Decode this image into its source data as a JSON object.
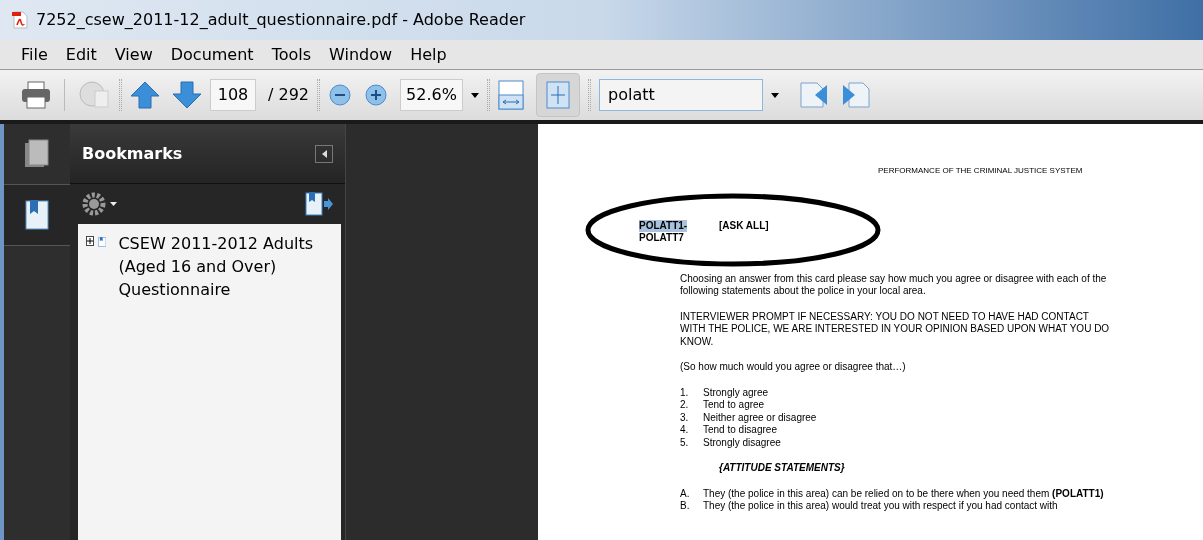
{
  "window": {
    "title": "7252_csew_2011-12_adult_questionnaire.pdf - Adobe Reader"
  },
  "menu": [
    "File",
    "Edit",
    "View",
    "Document",
    "Tools",
    "Window",
    "Help"
  ],
  "toolbar": {
    "page": "108",
    "page_total": "/ 292",
    "zoom": "52.6%",
    "search": "polatt",
    "fit_page_selected": true
  },
  "bookmarks": {
    "title": "Bookmarks",
    "items": [
      {
        "label": "CSEW 2011-2012 Adults (Aged 16 and Over) Questionnaire",
        "expanded": false
      }
    ]
  },
  "document": {
    "header": "PERFORMANCE OF THE CRIMINAL JUSTICE SYSTEM",
    "code_lines": [
      {
        "text": "POLATT1-",
        "selected": true
      },
      {
        "text": "POLATT7",
        "selected": false
      }
    ],
    "ask": "[ASK ALL]",
    "question": "Choosing an answer from this card please say how much you agree or disagree with each of the following statements about the police in your local area.",
    "prompt": "INTERVIEWER PROMPT IF NECESSARY: YOU DO NOT NEED TO HAVE HAD CONTACT WITH THE POLICE, WE ARE INTERESTED IN YOUR OPINION BASED UPON WHAT YOU DO KNOW.",
    "lead": "(So how much would you agree or disagree that…)",
    "options": [
      {
        "num": "1.",
        "text": "Strongly agree"
      },
      {
        "num": "2.",
        "text": "Tend to agree"
      },
      {
        "num": "3.",
        "text": "Neither agree or disagree"
      },
      {
        "num": "4.",
        "text": "Tend to disagree"
      },
      {
        "num": "5.",
        "text": "Strongly disagree"
      }
    ],
    "section": "{ATTITUDE STATEMENTS}",
    "statements": [
      {
        "letter": "A.",
        "text": "They (the police in this area) can be relied on to be there when you need them **(POLATT1)**"
      },
      {
        "letter": "B.",
        "text": "They (the police in this area) would treat you with respect if you had contact with"
      }
    ]
  }
}
